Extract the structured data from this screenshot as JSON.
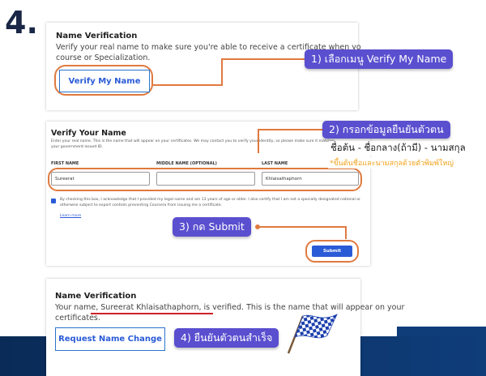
{
  "step": "4.",
  "panel1": {
    "title": "Name Verification",
    "description_line1": "Verify your real name to make sure you're able to receive a certificate when yo",
    "description_line2": "course or Specialization.",
    "button_label": "Verify My Name"
  },
  "callouts": {
    "c1": "1) เลือกเมนู Verify My Name",
    "c2": "2) กรอกข้อมูลยืนยันตัวตน",
    "c2_sub": "ชื่อต้น - ชื่อกลาง(ถ้ามี) - นามสกุล",
    "c2_note": "*ขึ้นต้นชื่อและนามสกุลด้วยตัวพิมพ์ใหญ่",
    "c3": "3) กด Submit",
    "c4": "4) ยืนยันตัวตนสำเร็จ"
  },
  "panel2": {
    "title": "Verify Your Name",
    "desc_line1": "Enter your real name. This is the name that will appear on your certificates. We may contact you to verify your identity, so please make sure it matches",
    "desc_line2": "your government-issued ID.",
    "first_name_label": "FIRST NAME",
    "middle_name_label": "MIDDLE NAME (OPTIONAL)",
    "last_name_label": "LAST NAME",
    "first_name_value": "Sureerat",
    "middle_name_value": "",
    "last_name_value": "Khlaisathaphorn",
    "consent_line1": "By checking this box, I acknowledge that I provided my legal name and am 13 years of age or older. I also certify that I am not a specially designated national or",
    "consent_line2": "otherwise subject to export controls preventing Coursera from issuing me a certificate.",
    "learn_more": "Learn more",
    "submit_label": "Submit"
  },
  "panel3": {
    "title": "Name Verification",
    "text_prefix": "Your name, ",
    "verified_name": "Sureerat Khlaisathaphorn, is verified",
    "text_suffix": ". This is the name that will appear on your",
    "text_line2": "certificates.",
    "button_label": "Request Name Change"
  },
  "colors": {
    "accent_blue": "#2a5bd7",
    "callout_purple": "#5a4fcf",
    "highlight_orange": "#e07a3f",
    "underline_red": "#d0212a",
    "band_navy": "#0f3d7a"
  },
  "icons": [
    "checkered-flag-icon"
  ]
}
